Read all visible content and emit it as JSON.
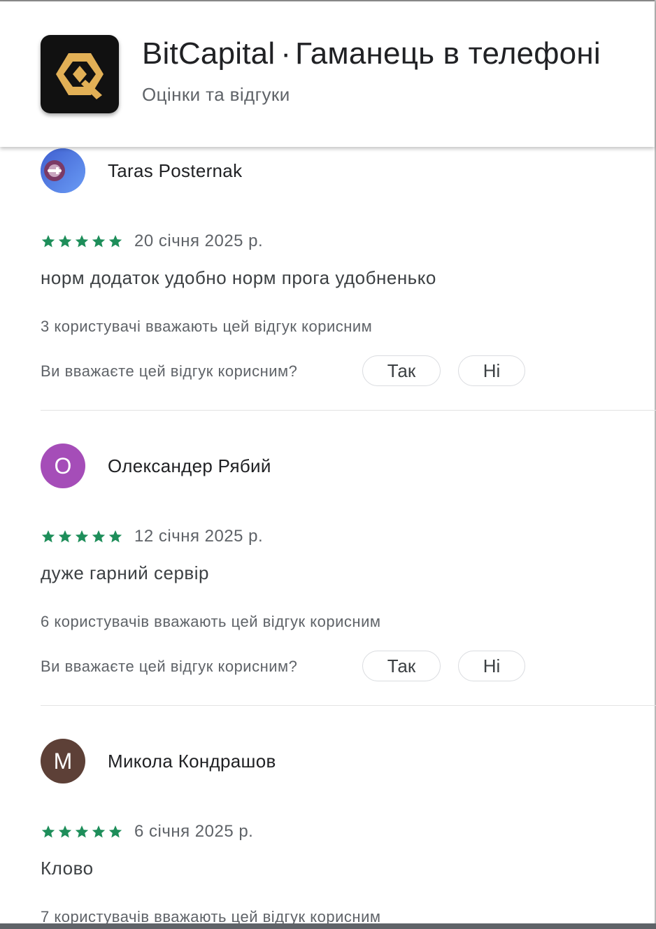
{
  "app": {
    "name": "BitCapital",
    "separator": "·",
    "tagline": "Гаманець в телефоні",
    "subtitle": "Оцінки та відгуки",
    "icon": "bitcapital-logo",
    "icon_colors": {
      "background": "#111111",
      "accent": "#e2b056"
    }
  },
  "colors": {
    "star": "#1e8e5a",
    "avatar_purple": "#a54db8",
    "avatar_brown": "#5d4037",
    "avatar_blue": "#4285f4"
  },
  "reviews": [
    {
      "author": "Taras Posternak",
      "avatar_type": "photo",
      "avatar_initial": "",
      "rating": 5,
      "date": "20 січня 2025 р.",
      "text": "норм додаток удобно норм прога удобненько",
      "helpful_count_text": "3 користувачі вважають цей відгук корисним",
      "helpful_question": "Ви вважаєте цей відгук корисним?",
      "yes_label": "Так",
      "no_label": "Ні"
    },
    {
      "author": "Олександер Рябий",
      "avatar_type": "initial",
      "avatar_initial": "О",
      "rating": 5,
      "date": "12 січня 2025 р.",
      "text": "дуже гарний сервір",
      "helpful_count_text": "6 користувачів вважають цей відгук корисним",
      "helpful_question": "Ви вважаєте цей відгук корисним?",
      "yes_label": "Так",
      "no_label": "Ні"
    },
    {
      "author": "Микола Кондрашов",
      "avatar_type": "initial",
      "avatar_initial": "М",
      "rating": 5,
      "date": "6 січня 2025 р.",
      "text": "Клово",
      "helpful_count_text": "7 користувачів вважають цей відгук корисним"
    }
  ]
}
